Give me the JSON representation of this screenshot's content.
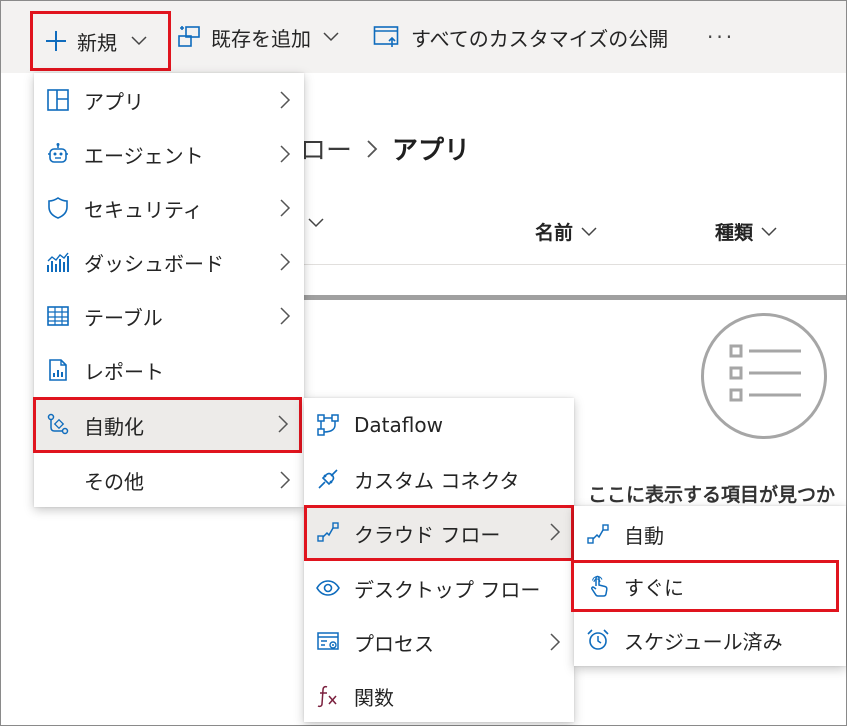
{
  "toolbar": {
    "new_label": "新規",
    "add_existing_label": "既存を追加",
    "publish_label": "すべてのカスタマイズの公開",
    "more_label": "···"
  },
  "page": {
    "breadcrumb_prev": "ロー",
    "breadcrumb_current": "アプリ",
    "columns": [
      "名前",
      "種類"
    ],
    "empty_message": "ここに表示する項目が見つか"
  },
  "new_menu": {
    "items": [
      {
        "label": "アプリ",
        "icon": "app-grid-icon",
        "submenu": true
      },
      {
        "label": "エージェント",
        "icon": "bot-icon",
        "submenu": true
      },
      {
        "label": "セキュリティ",
        "icon": "shield-icon",
        "submenu": true
      },
      {
        "label": "ダッシュボード",
        "icon": "dashboard-chart-icon",
        "submenu": true
      },
      {
        "label": "テーブル",
        "icon": "table-icon",
        "submenu": true
      },
      {
        "label": "レポート",
        "icon": "report-icon",
        "submenu": false
      },
      {
        "label": "自動化",
        "icon": "automation-flow-icon",
        "submenu": true,
        "selected": true
      },
      {
        "label": "その他",
        "icon": "",
        "submenu": true
      }
    ]
  },
  "automation_menu": {
    "items": [
      {
        "label": "Dataflow",
        "icon": "dataflow-icon",
        "submenu": false
      },
      {
        "label": "カスタム コネクタ",
        "icon": "connector-plug-icon",
        "submenu": false
      },
      {
        "label": "クラウド フロー",
        "icon": "cloud-flow-icon",
        "submenu": true,
        "selected": true
      },
      {
        "label": "デスクトップ フロー",
        "icon": "eye-icon",
        "submenu": false
      },
      {
        "label": "プロセス",
        "icon": "process-icon",
        "submenu": true
      },
      {
        "label": "関数",
        "icon": "function-fx-icon",
        "submenu": false
      }
    ]
  },
  "cloud_flow_menu": {
    "items": [
      {
        "label": "自動",
        "icon": "flow-icon"
      },
      {
        "label": "すぐに",
        "icon": "touch-icon",
        "highlighted": true
      },
      {
        "label": "スケジュール済み",
        "icon": "alarm-clock-icon"
      }
    ]
  },
  "colors": {
    "accent": "#0f6cbd",
    "highlight_border": "#e0141e",
    "toolbar_bg": "#f3f2f1",
    "selected_bg": "#edebe9",
    "function_icon": "#7a1f3d"
  }
}
